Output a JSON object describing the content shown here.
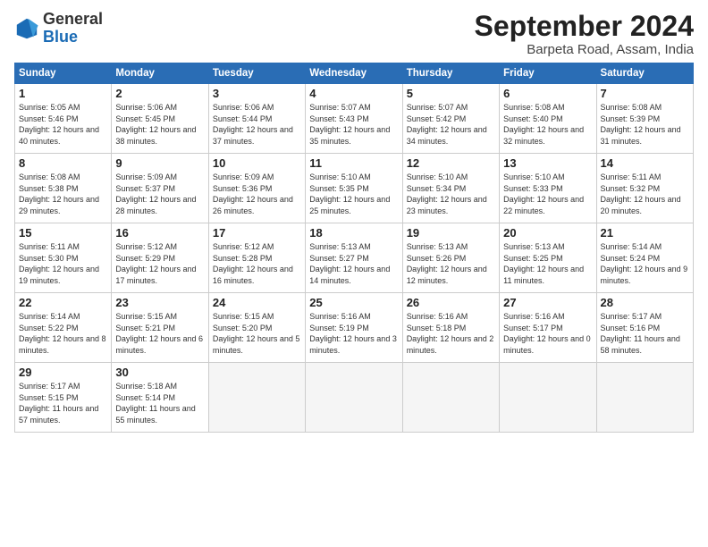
{
  "header": {
    "logo_general": "General",
    "logo_blue": "Blue",
    "month_title": "September 2024",
    "subtitle": "Barpeta Road, Assam, India"
  },
  "days_of_week": [
    "Sunday",
    "Monday",
    "Tuesday",
    "Wednesday",
    "Thursday",
    "Friday",
    "Saturday"
  ],
  "weeks": [
    [
      {
        "day": 1,
        "sunrise": "5:05 AM",
        "sunset": "5:46 PM",
        "daylight": "12 hours and 40 minutes."
      },
      {
        "day": 2,
        "sunrise": "5:06 AM",
        "sunset": "5:45 PM",
        "daylight": "12 hours and 38 minutes."
      },
      {
        "day": 3,
        "sunrise": "5:06 AM",
        "sunset": "5:44 PM",
        "daylight": "12 hours and 37 minutes."
      },
      {
        "day": 4,
        "sunrise": "5:07 AM",
        "sunset": "5:43 PM",
        "daylight": "12 hours and 35 minutes."
      },
      {
        "day": 5,
        "sunrise": "5:07 AM",
        "sunset": "5:42 PM",
        "daylight": "12 hours and 34 minutes."
      },
      {
        "day": 6,
        "sunrise": "5:08 AM",
        "sunset": "5:40 PM",
        "daylight": "12 hours and 32 minutes."
      },
      {
        "day": 7,
        "sunrise": "5:08 AM",
        "sunset": "5:39 PM",
        "daylight": "12 hours and 31 minutes."
      }
    ],
    [
      {
        "day": 8,
        "sunrise": "5:08 AM",
        "sunset": "5:38 PM",
        "daylight": "12 hours and 29 minutes."
      },
      {
        "day": 9,
        "sunrise": "5:09 AM",
        "sunset": "5:37 PM",
        "daylight": "12 hours and 28 minutes."
      },
      {
        "day": 10,
        "sunrise": "5:09 AM",
        "sunset": "5:36 PM",
        "daylight": "12 hours and 26 minutes."
      },
      {
        "day": 11,
        "sunrise": "5:10 AM",
        "sunset": "5:35 PM",
        "daylight": "12 hours and 25 minutes."
      },
      {
        "day": 12,
        "sunrise": "5:10 AM",
        "sunset": "5:34 PM",
        "daylight": "12 hours and 23 minutes."
      },
      {
        "day": 13,
        "sunrise": "5:10 AM",
        "sunset": "5:33 PM",
        "daylight": "12 hours and 22 minutes."
      },
      {
        "day": 14,
        "sunrise": "5:11 AM",
        "sunset": "5:32 PM",
        "daylight": "12 hours and 20 minutes."
      }
    ],
    [
      {
        "day": 15,
        "sunrise": "5:11 AM",
        "sunset": "5:30 PM",
        "daylight": "12 hours and 19 minutes."
      },
      {
        "day": 16,
        "sunrise": "5:12 AM",
        "sunset": "5:29 PM",
        "daylight": "12 hours and 17 minutes."
      },
      {
        "day": 17,
        "sunrise": "5:12 AM",
        "sunset": "5:28 PM",
        "daylight": "12 hours and 16 minutes."
      },
      {
        "day": 18,
        "sunrise": "5:13 AM",
        "sunset": "5:27 PM",
        "daylight": "12 hours and 14 minutes."
      },
      {
        "day": 19,
        "sunrise": "5:13 AM",
        "sunset": "5:26 PM",
        "daylight": "12 hours and 12 minutes."
      },
      {
        "day": 20,
        "sunrise": "5:13 AM",
        "sunset": "5:25 PM",
        "daylight": "12 hours and 11 minutes."
      },
      {
        "day": 21,
        "sunrise": "5:14 AM",
        "sunset": "5:24 PM",
        "daylight": "12 hours and 9 minutes."
      }
    ],
    [
      {
        "day": 22,
        "sunrise": "5:14 AM",
        "sunset": "5:22 PM",
        "daylight": "12 hours and 8 minutes."
      },
      {
        "day": 23,
        "sunrise": "5:15 AM",
        "sunset": "5:21 PM",
        "daylight": "12 hours and 6 minutes."
      },
      {
        "day": 24,
        "sunrise": "5:15 AM",
        "sunset": "5:20 PM",
        "daylight": "12 hours and 5 minutes."
      },
      {
        "day": 25,
        "sunrise": "5:16 AM",
        "sunset": "5:19 PM",
        "daylight": "12 hours and 3 minutes."
      },
      {
        "day": 26,
        "sunrise": "5:16 AM",
        "sunset": "5:18 PM",
        "daylight": "12 hours and 2 minutes."
      },
      {
        "day": 27,
        "sunrise": "5:16 AM",
        "sunset": "5:17 PM",
        "daylight": "12 hours and 0 minutes."
      },
      {
        "day": 28,
        "sunrise": "5:17 AM",
        "sunset": "5:16 PM",
        "daylight": "11 hours and 58 minutes."
      }
    ],
    [
      {
        "day": 29,
        "sunrise": "5:17 AM",
        "sunset": "5:15 PM",
        "daylight": "11 hours and 57 minutes."
      },
      {
        "day": 30,
        "sunrise": "5:18 AM",
        "sunset": "5:14 PM",
        "daylight": "11 hours and 55 minutes."
      },
      null,
      null,
      null,
      null,
      null
    ]
  ]
}
